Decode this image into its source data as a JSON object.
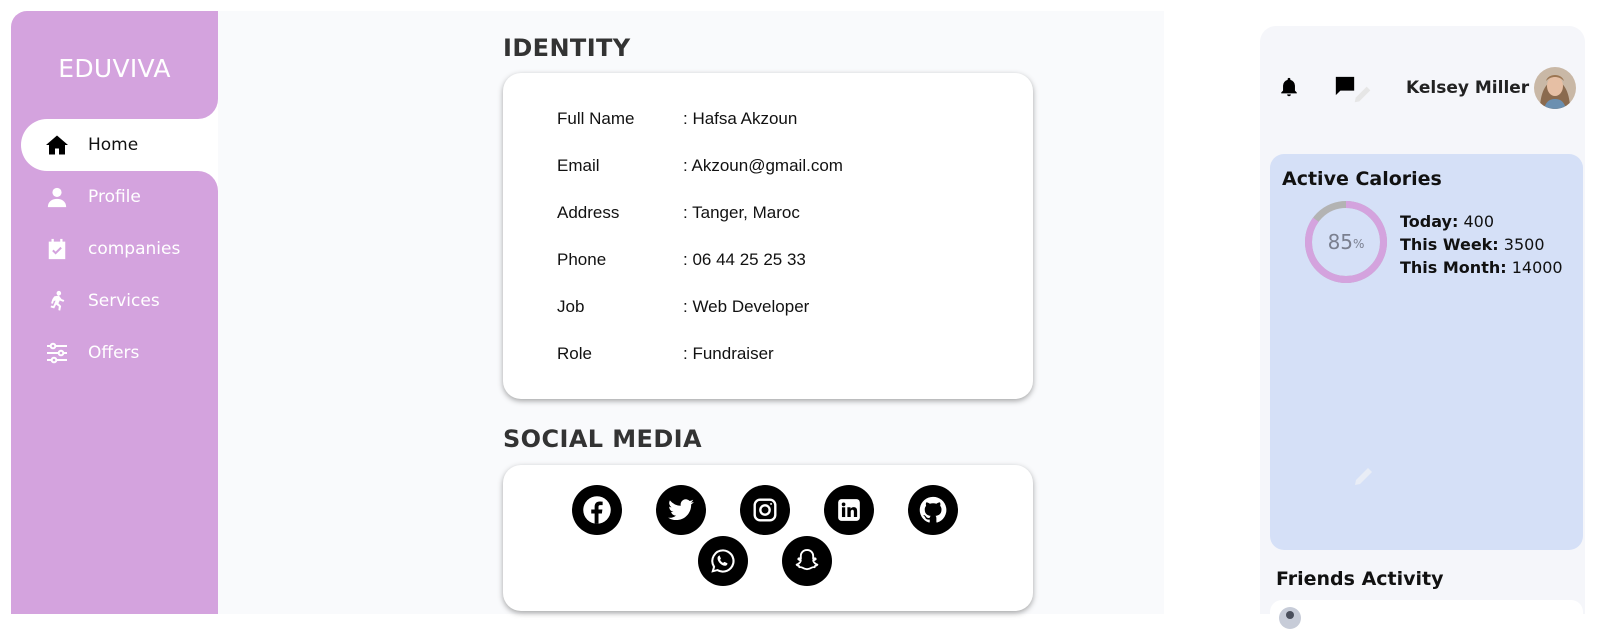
{
  "sidebar": {
    "brand": "EDUVIVA",
    "items": [
      {
        "label": "Home",
        "icon": "home-icon",
        "active": true
      },
      {
        "label": "Profile",
        "icon": "user-icon"
      },
      {
        "label": "companies",
        "icon": "calendar-check-icon"
      },
      {
        "label": "Services",
        "icon": "runner-icon"
      },
      {
        "label": "Offers",
        "icon": "sliders-icon"
      }
    ]
  },
  "identity": {
    "title": "IDENTITY",
    "rows": [
      {
        "label": "Full Name",
        "value": ": Hafsa Akzoun"
      },
      {
        "label": "Email",
        "value": ": Akzoun@gmail.com"
      },
      {
        "label": "Address",
        "value": ": Tanger, Maroc"
      },
      {
        "label": "Phone",
        "value": ": 06 44 25 25 33"
      },
      {
        "label": "Job",
        "value": ": Web Developer"
      },
      {
        "label": "Role",
        "value": ": Fundraiser"
      }
    ]
  },
  "social": {
    "title": "SOCIAL MEDIA",
    "icons": [
      "facebook-icon",
      "twitter-icon",
      "instagram-icon",
      "linkedin-icon",
      "github-icon",
      "whatsapp-icon",
      "snapchat-icon"
    ]
  },
  "header": {
    "username": "Kelsey Miller"
  },
  "calories": {
    "title": "Active Calories",
    "percent_value": "85",
    "percent_unit": "%",
    "percent_fraction": 0.85,
    "today_label": "Today:",
    "today_value": " 400",
    "week_label": "This Week:",
    "week_value": " 3500",
    "month_label": "This Month:",
    "month_value": " 14000"
  },
  "friends": {
    "title": "Friends Activity"
  },
  "colors": {
    "sidebar": "#d4a3de",
    "ring": "#d4a3de",
    "ring_track": "#b3b3b3",
    "calorie_card": "#d5e0f7"
  }
}
